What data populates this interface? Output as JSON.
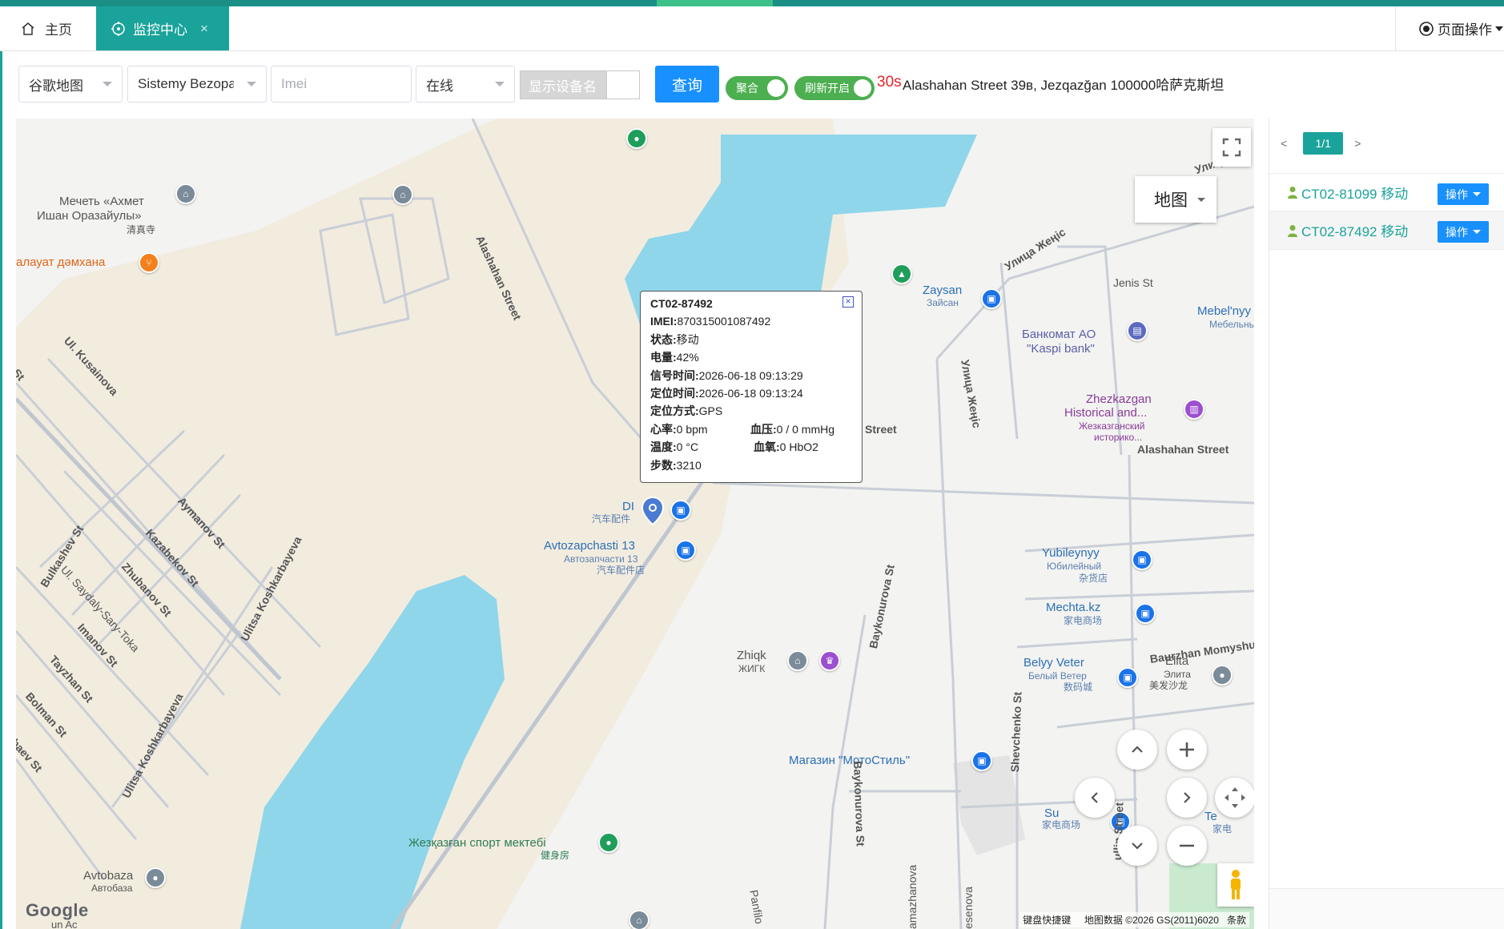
{
  "tabs": {
    "home_label": "主页",
    "monitor_label": "监控中心",
    "close_symbol": "×",
    "page_ops_label": "页面操作"
  },
  "toolbar": {
    "map_select": "谷歌地图",
    "group_select": "Sistemy Bezopasnosti",
    "imei_placeholder": "Imei",
    "status_select": "在线",
    "show_name_label": "显示设备名",
    "query_label": "查询",
    "cluster_label": "聚合",
    "refresh_label": "刷新开启",
    "refresh_seconds": "30s",
    "address": "Alashahan Street 39в, Jezqazğan 100000哈萨克斯坦"
  },
  "map": {
    "type_label": "地图",
    "attribution_shortcuts": "键盘快捷键",
    "attribution_data": "地图数据 ©2026 GS(2011)6020",
    "attribution_terms": "条款",
    "google": "Google",
    "labels": {
      "mosque_1": "Мечеть «Ахмет",
      "mosque_2": "Ишан Оразайулы»",
      "mosque_3": "清真寺",
      "damkhana": "алауат дәмхана",
      "alashahan_diag": "Alashahan Street",
      "kusainova": "Ul. Kusainova",
      "st_left": "St",
      "aymanov": "Aymanov St",
      "kazabekov": "Kazabekov St",
      "zhubanov": "Zhubanov St",
      "bulkashev": "Bulkashev St",
      "saydaly": "Ul. Saydaly-Sary-Toka",
      "imanov": "Imanov St",
      "tayzhan": "Tayzhan St",
      "bolman": "Bolman St",
      "baev": "baev St",
      "koshkarbayeva_1": "Ulitsa Koshkarbayeva",
      "koshkarbayeva_2": "Ulitsa Koshkarbayeva",
      "zhenis_top": "Улица Жеңіс",
      "uli": "Улиц",
      "jenis": "Jenis St",
      "zaysan": "Zaysan",
      "zaysan_ru": "Зайсан",
      "bankomat_1": "Банкомат АО",
      "bankomat_2": "\"Kaspi bank\"",
      "mebel": "Mebel'nyy T",
      "mebel_ru": "Мебельны",
      "zhenis_vert": "Улица Жеңіс",
      "zhezk_1": "Zhezkazgan",
      "zhezk_2": "Historical and...",
      "zhezk_3": "Жезказганский",
      "zhezk_4": "историко...",
      "street_frag": "Street",
      "alashahan_h": "Alashahan Street",
      "di": "DI",
      "di_sub": "汽车配件",
      "avto_1": "Avtozapchasti 13",
      "avto_2": "Автозапчасти 13",
      "avto_3": "汽车配件店",
      "yubil_1": "Yubileynyy",
      "yubil_2": "Юбилейный",
      "yubil_3": "杂货店",
      "mechta_1": "Mechta.kz",
      "mechta_2": "家电商场",
      "baykonurova": "Baykonurova St",
      "baurzhan": "Baurzhan Momyshuly",
      "zhiqk_1": "Zhiqk",
      "zhiqk_2": "ЖИГК",
      "belyy_1": "Belyy Veter",
      "belyy_2": "Белый Ветер",
      "belyy_3": "数码城",
      "elita_1": "Elita",
      "elita_2": "Элита",
      "elita_3": "美发沙龙",
      "magazin": "Магазин \"МотоСтиль\"",
      "baykonurova_2": "Baykonurova St",
      "shevchenko": "Shevchenko St",
      "su": "Su",
      "su_sub": "家电商场",
      "te": "Te",
      "te_sub": "家电",
      "ullin": "ullin Street",
      "sport_1": "Жезқазған спорт мектебі",
      "sport_2": "健身房",
      "avtobaza_1": "Avtobaza",
      "avtobaza_2": "Автобаза",
      "amazhanova": "amazhanova",
      "panfilo": "Panfilo",
      "esenova": "esenova",
      "un": "un Ac"
    }
  },
  "popup": {
    "device": "CT02-87492",
    "imei_label": "IMEI:",
    "imei": "870315001087492",
    "status_label": "状态:",
    "status": "移动",
    "battery_label": "电量:",
    "battery": "42%",
    "signal_time_label": "信号时间:",
    "signal_time": "2026-06-18 09:13:29",
    "locate_time_label": "定位时间:",
    "locate_time": "2026-06-18 09:13:24",
    "locate_mode_label": "定位方式:",
    "locate_mode": "GPS",
    "heart_label": "心率:",
    "heart": "0 bpm",
    "bp_label": "血压:",
    "bp": "0 / 0 mmHg",
    "temp_label": "温度:",
    "temp": "0 °C",
    "oxygen_label": "血氧:",
    "oxygen": "0 HbO2",
    "steps_label": "步数:",
    "steps": "3210",
    "close_symbol": "×"
  },
  "panel": {
    "prev": "<",
    "page": "1/1",
    "next": ">",
    "op_label": "操作",
    "devices": [
      {
        "name": "CT02-81099 移动"
      },
      {
        "name": "CT02-87492 移动"
      }
    ]
  },
  "colors": {
    "accent": "#1aa39a",
    "primary": "#1890ff",
    "toggle": "#4caf50",
    "water": "#8fd6ea",
    "land": "#f2ecdf"
  }
}
